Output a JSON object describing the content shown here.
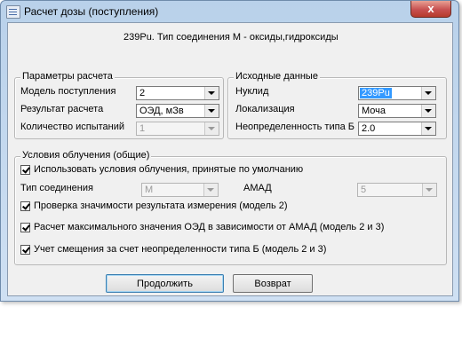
{
  "window": {
    "title": "Расчет дозы (поступления)",
    "close_glyph": "x"
  },
  "subtitle": "239Pu. Тип соединения М - оксиды,гидроксиды",
  "calc_params": {
    "title": "Параметры расчета",
    "intake_model_label": "Модель поступления",
    "intake_model_value": "2",
    "result_label": "Результат расчета",
    "result_value": "ОЭД, мЗв",
    "trials_label": "Количество испытаний",
    "trials_value": "1"
  },
  "input_data": {
    "title": "Исходные данные",
    "nuclide_label": "Нуклид",
    "nuclide_value": "239Pu",
    "localization_label": "Локализация",
    "localization_value": "Моча",
    "uncertainty_label": "Неопределенность типа Б",
    "uncertainty_value": "2.0"
  },
  "exposure": {
    "title": "Условия облучения (общие)",
    "use_defaults_label": "Использовать условия облучения, принятые по умолчанию",
    "compound_type_label": "Тип соединения",
    "compound_type_value": "М",
    "amad_label": "АМАД",
    "amad_value": "5",
    "check_significance_label": "Проверка значимости результата измерения (модель 2)",
    "calc_max_label": "Расчет максимального значения ОЭД в зависимости от АМАД (модель 2 и 3)",
    "bias_label": "Учет смещения за счет неопределенности типа Б (модель 2 и 3)"
  },
  "buttons": {
    "continue": "Продолжить",
    "back": "Возврат"
  }
}
